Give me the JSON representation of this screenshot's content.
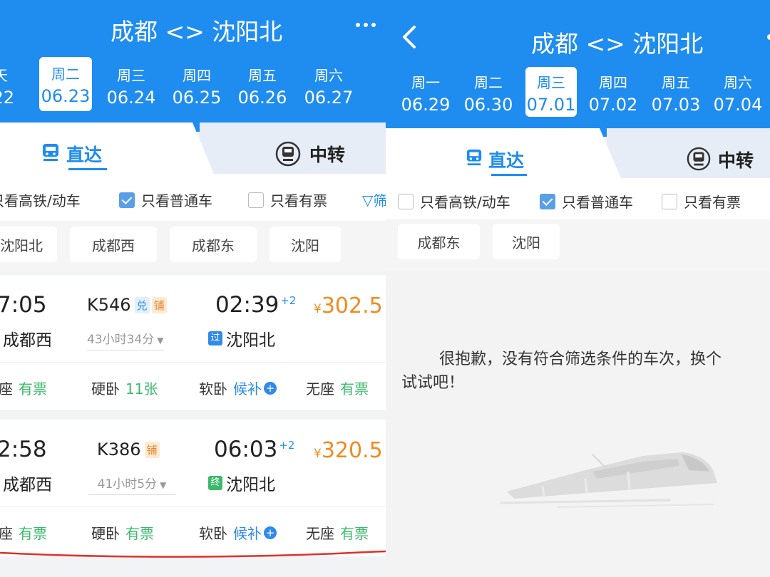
{
  "left": {
    "title": "成都 <> 沈阳北",
    "dates": [
      {
        "weekday": "天",
        "date": ".22",
        "selected": false
      },
      {
        "weekday": "周二",
        "date": "06.23",
        "selected": true
      },
      {
        "weekday": "周三",
        "date": "06.24",
        "selected": false
      },
      {
        "weekday": "周四",
        "date": "06.25",
        "selected": false
      },
      {
        "weekday": "周五",
        "date": "06.26",
        "selected": false
      },
      {
        "weekday": "周六",
        "date": "06.27",
        "selected": false
      }
    ],
    "tabs": {
      "direct": "直达",
      "transfer": "中转"
    },
    "filters": {
      "hsr": "只看高铁/动车",
      "normal": "只看普通车",
      "available": "只看有票",
      "filter_icon": "funnel-icon",
      "more": "筛"
    },
    "stations": [
      "沈阳北",
      "成都西",
      "成都东",
      "沈阳"
    ],
    "trains": [
      {
        "depart": "7:05",
        "depart_station": "成都西",
        "train_no": "K546",
        "badges": [
          "兑",
          "铺"
        ],
        "duration": "43小时34分",
        "arrive": "02:39",
        "day_offset": "+2",
        "arrive_badge": "过",
        "arrive_station": "沈阳北",
        "price_symbol": "¥",
        "price": "302.5",
        "seats": [
          {
            "type": "座",
            "status": "有票",
            "color": "green"
          },
          {
            "type": "硬卧",
            "status": "11张",
            "color": "green"
          },
          {
            "type": "软卧",
            "status": "候补",
            "color": "blue"
          },
          {
            "type": "无座",
            "status": "有票",
            "color": "green"
          }
        ]
      },
      {
        "depart": "2:58",
        "depart_station": "成都西",
        "train_no": "K386",
        "badges": [
          "铺"
        ],
        "duration": "41小时5分",
        "arrive": "06:03",
        "day_offset": "+2",
        "arrive_badge": "终",
        "arrive_station": "沈阳北",
        "price_symbol": "¥",
        "price": "320.5",
        "seats": [
          {
            "type": "座",
            "status": "有票",
            "color": "green"
          },
          {
            "type": "硬卧",
            "status": "有票",
            "color": "green"
          },
          {
            "type": "软卧",
            "status": "候补",
            "color": "blue"
          },
          {
            "type": "无座",
            "status": "有票",
            "color": "green"
          }
        ]
      }
    ]
  },
  "right": {
    "title": "成都 <> 沈阳北",
    "dates": [
      {
        "weekday": "周一",
        "date": "06.29",
        "selected": false
      },
      {
        "weekday": "周二",
        "date": "06.30",
        "selected": false
      },
      {
        "weekday": "周三",
        "date": "07.01",
        "selected": true
      },
      {
        "weekday": "周四",
        "date": "07.02",
        "selected": false
      },
      {
        "weekday": "周五",
        "date": "07.03",
        "selected": false
      },
      {
        "weekday": "周六",
        "date": "07.04",
        "selected": false
      }
    ],
    "tabs": {
      "direct": "直达",
      "transfer": "中转"
    },
    "filters": {
      "hsr": "只看高铁/动车",
      "normal": "只看普通车",
      "available": "只看有票"
    },
    "stations": [
      "成都东",
      "沈阳"
    ],
    "empty_line1": "很抱歉，没有符合筛选条件的车次，换个",
    "empty_line2": "试试吧！"
  },
  "colors": {
    "header_blue": "#1f8cf0",
    "price_orange": "#f28a1f",
    "status_green": "#3cba6b",
    "status_blue": "#2f8ae8",
    "annotation_red": "#e0302a"
  }
}
